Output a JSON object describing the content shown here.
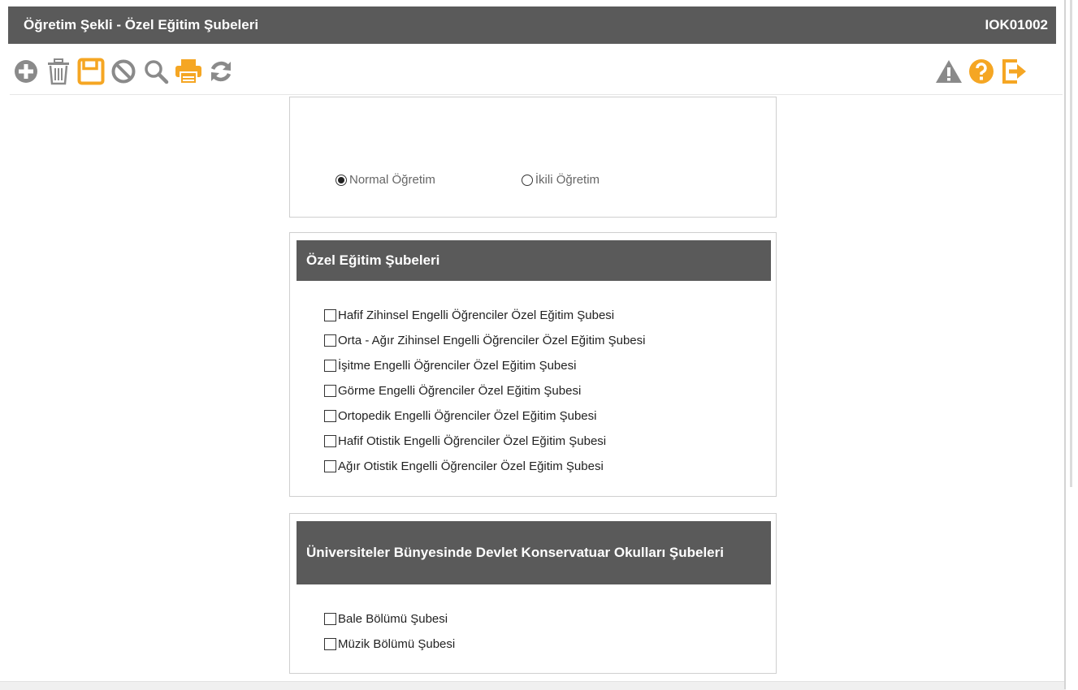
{
  "window": {
    "title": "Öğretim Şekli - Özel Eğitim Şubeleri",
    "code": "IOK01002"
  },
  "toolbar": {
    "left": [
      {
        "name": "add-icon",
        "color": "#8a8a8a"
      },
      {
        "name": "trash-icon",
        "color": "#8a8a8a"
      },
      {
        "name": "save-icon",
        "color": "#f5a623"
      },
      {
        "name": "cancel-icon",
        "color": "#8a8a8a"
      },
      {
        "name": "search-icon",
        "color": "#8a8a8a"
      },
      {
        "name": "print-icon",
        "color": "#f5a623"
      },
      {
        "name": "refresh-icon",
        "color": "#8a8a8a"
      }
    ],
    "right": [
      {
        "name": "warning-icon",
        "color": "#8a8a8a"
      },
      {
        "name": "help-icon",
        "color": "#f5a623"
      },
      {
        "name": "exit-icon",
        "color": "#f5a623"
      }
    ]
  },
  "teaching_type": {
    "options": [
      {
        "label": "Normal Öğretim",
        "selected": true
      },
      {
        "label": "İkili Öğretim",
        "selected": false
      }
    ]
  },
  "special_education": {
    "header": "Özel Eğitim Şubeleri",
    "items": [
      {
        "label": "Hafif Zihinsel Engelli Öğrenciler Özel Eğitim Şubesi",
        "checked": false
      },
      {
        "label": "Orta - Ağır Zihinsel Engelli Öğrenciler Özel Eğitim Şubesi",
        "checked": false
      },
      {
        "label": "İşitme Engelli Öğrenciler Özel Eğitim Şubesi",
        "checked": false
      },
      {
        "label": "Görme Engelli Öğrenciler Özel Eğitim Şubesi",
        "checked": false
      },
      {
        "label": "Ortopedik Engelli Öğrenciler Özel Eğitim Şubesi",
        "checked": false
      },
      {
        "label": "Hafif Otistik Engelli Öğrenciler Özel Eğitim Şubesi",
        "checked": false
      },
      {
        "label": "Ağır Otistik Engelli Öğrenciler Özel Eğitim Şubesi",
        "checked": false
      }
    ]
  },
  "conservatory": {
    "header": "Üniversiteler Bünyesinde Devlet Konservatuar Okulları Şubeleri",
    "items": [
      {
        "label": "Bale Bölümü Şubesi",
        "checked": false
      },
      {
        "label": "Müzik Bölümü Şubesi",
        "checked": false
      }
    ]
  },
  "colors": {
    "header_bg": "#5a5a5a",
    "accent_orange": "#f5a623",
    "icon_gray": "#8a8a8a"
  }
}
